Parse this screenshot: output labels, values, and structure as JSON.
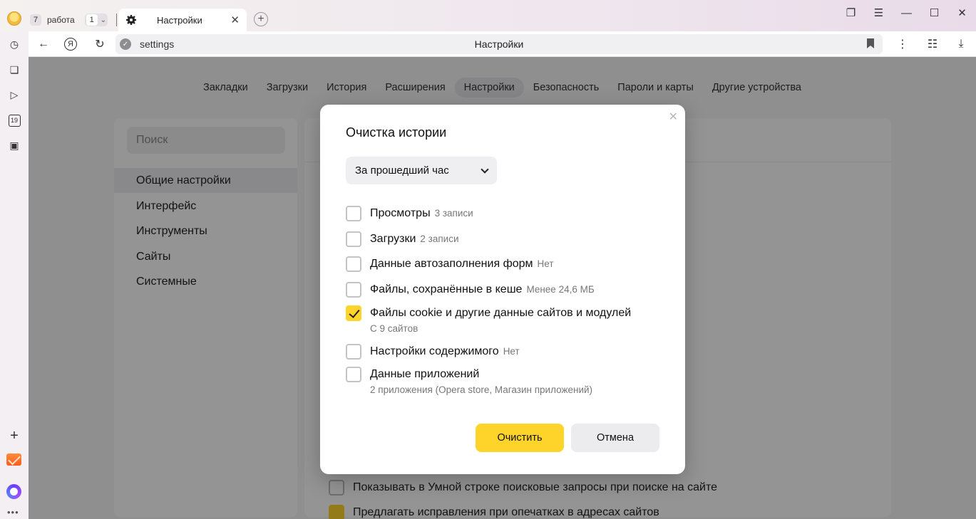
{
  "workspace": {
    "count": "7",
    "name": "работа",
    "group_count": "1"
  },
  "tab": {
    "title": "Настройки"
  },
  "address": {
    "url": "settings",
    "page_title": "Настройки"
  },
  "nav": {
    "items": [
      "Закладки",
      "Загрузки",
      "История",
      "Расширения",
      "Настройки",
      "Безопасность",
      "Пароли и карты",
      "Другие устройства"
    ],
    "active": "Настройки"
  },
  "sidebar": {
    "search_placeholder": "Поиск",
    "items": [
      "Общие настройки",
      "Интерфейс",
      "Инструменты",
      "Сайты",
      "Системные"
    ]
  },
  "rail": {
    "calendar_day": "19"
  },
  "background_options": [
    {
      "label": "Показывать в Умной строке поисковые запросы при поиске на сайте",
      "checked": false
    },
    {
      "label": "Предлагать исправления при опечатках в адресах сайтов",
      "checked": true
    }
  ],
  "dialog": {
    "title": "Очистка истории",
    "period": "За прошедший час",
    "options": [
      {
        "label": "Просмотры",
        "note": "3 записи",
        "sub": "",
        "checked": false
      },
      {
        "label": "Загрузки",
        "note": "2 записи",
        "sub": "",
        "checked": false
      },
      {
        "label": "Данные автозаполнения форм",
        "note": "Нет",
        "sub": "",
        "checked": false
      },
      {
        "label": "Файлы, сохранённые в кеше",
        "note": "Менее 24,6 МБ",
        "sub": "",
        "checked": false
      },
      {
        "label": "Файлы cookie и другие данные сайтов и модулей",
        "note": "",
        "sub": "С 9 сайтов",
        "checked": true
      },
      {
        "label": "Настройки содержимого",
        "note": "Нет",
        "sub": "",
        "checked": false
      },
      {
        "label": "Данные приложений",
        "note": "",
        "sub": "2 приложения (Opera store, Магазин приложений)",
        "checked": false
      }
    ],
    "confirm_label": "Очистить",
    "cancel_label": "Отмена"
  }
}
